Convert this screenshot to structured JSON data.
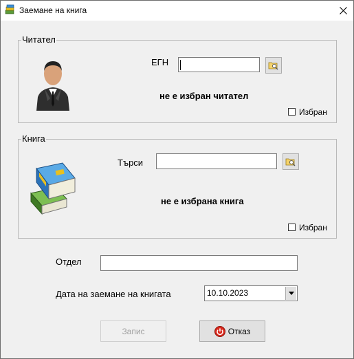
{
  "window": {
    "title": "Заемане на книга"
  },
  "reader": {
    "legend": "Читател",
    "egn_label": "ЕГН",
    "egn_value": "",
    "status": "не е избран читател",
    "selected_label": "Избран"
  },
  "book": {
    "legend": "Книга",
    "search_label": "Търси",
    "search_value": "",
    "status": "не е избрана книга",
    "selected_label": "Избран"
  },
  "department": {
    "label": "Отдел",
    "value": ""
  },
  "loan_date": {
    "label": "Дата на заемане на книгата",
    "value": "10.10.2023"
  },
  "buttons": {
    "save": "Запис",
    "cancel": "Отказ"
  },
  "colors": {
    "cancel_icon": "#d92b1f",
    "book_blue": "#3a8fd6",
    "book_green": "#5b9a3a"
  }
}
